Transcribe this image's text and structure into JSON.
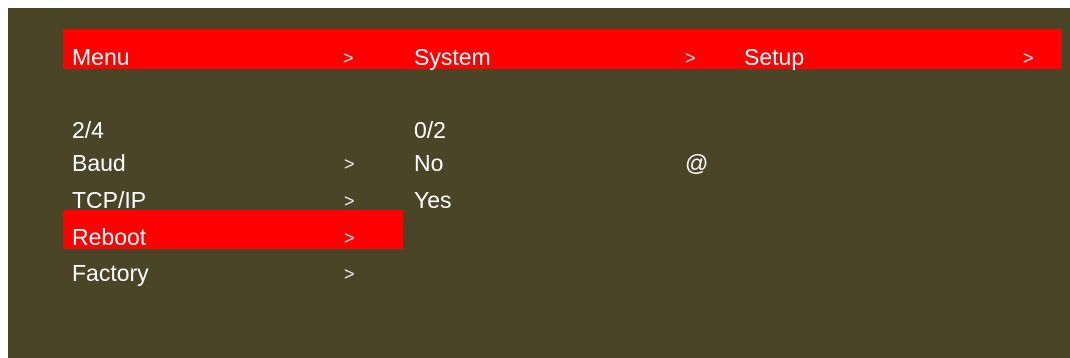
{
  "colors": {
    "background": "#4b4528",
    "highlight": "#fe0000",
    "text": "#ffffff"
  },
  "breadcrumb": {
    "items": [
      "Menu",
      "System",
      "Setup"
    ],
    "separator": ">"
  },
  "left_panel": {
    "page_indicator": "2/4",
    "items": [
      {
        "label": "Baud",
        "arrow": ">",
        "selected": false
      },
      {
        "label": "TCP/IP",
        "arrow": ">",
        "selected": false
      },
      {
        "label": "Reboot",
        "arrow": ">",
        "selected": true
      },
      {
        "label": "Factory",
        "arrow": ">",
        "selected": false
      }
    ]
  },
  "right_panel": {
    "page_indicator": "0/2",
    "options": [
      {
        "label": "No",
        "marker": "@"
      },
      {
        "label": "Yes",
        "marker": ""
      }
    ]
  }
}
